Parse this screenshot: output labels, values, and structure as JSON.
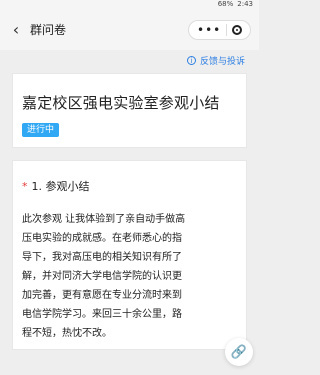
{
  "status_bar": {
    "battery": "68%",
    "time": "2:43"
  },
  "nav": {
    "title": "群问卷",
    "back_icon": "chevron-left-icon",
    "more_icon": "more-icon",
    "close_icon": "close-icon"
  },
  "feedback": {
    "label": "反馈与投诉",
    "icon": "info-icon"
  },
  "survey": {
    "title": "嘉定校区强电实验室参观小结",
    "status": "进行中"
  },
  "question": {
    "required_mark": "*",
    "label": "1. 参观小结",
    "answer": "此次参观 让我体验到了亲自动手做高\n压电实验的成就感。在老师悉心的指\n导下，我对高压电的相关知识有所了\n解，并对同济大学电信学院的认识更\n加完善，更有意愿在专业分流时来到\n电信学院学习。来回三十余公里，路\n程不短，热忱不改。"
  },
  "floating_button": {
    "icon": "link-icon"
  },
  "colors": {
    "accent": "#2d7fe3",
    "status_badge": "#31a8f3",
    "required": "#e23a3a",
    "background": "#eeeeee"
  }
}
